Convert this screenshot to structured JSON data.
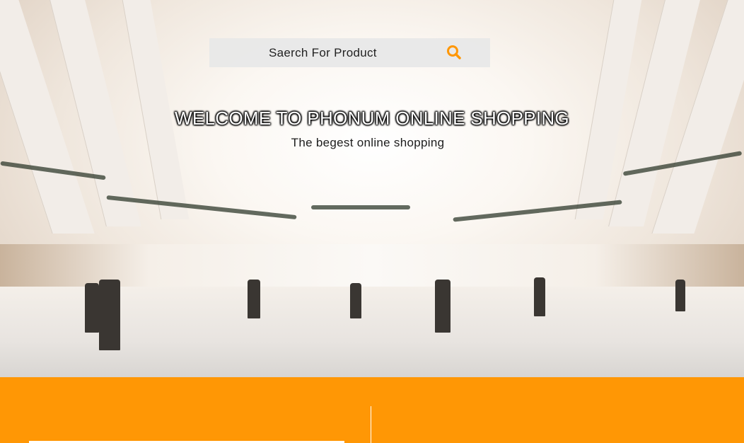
{
  "search": {
    "placeholder": "Saerch For Product",
    "icon": "search-icon",
    "icon_color": "#ff9705"
  },
  "hero": {
    "title": "WELCOME TO PHONUM ONLINE SHOPPING",
    "subtitle": "The begest online shopping"
  },
  "colors": {
    "accent": "#ff9705",
    "title_text": "#ffffff"
  }
}
